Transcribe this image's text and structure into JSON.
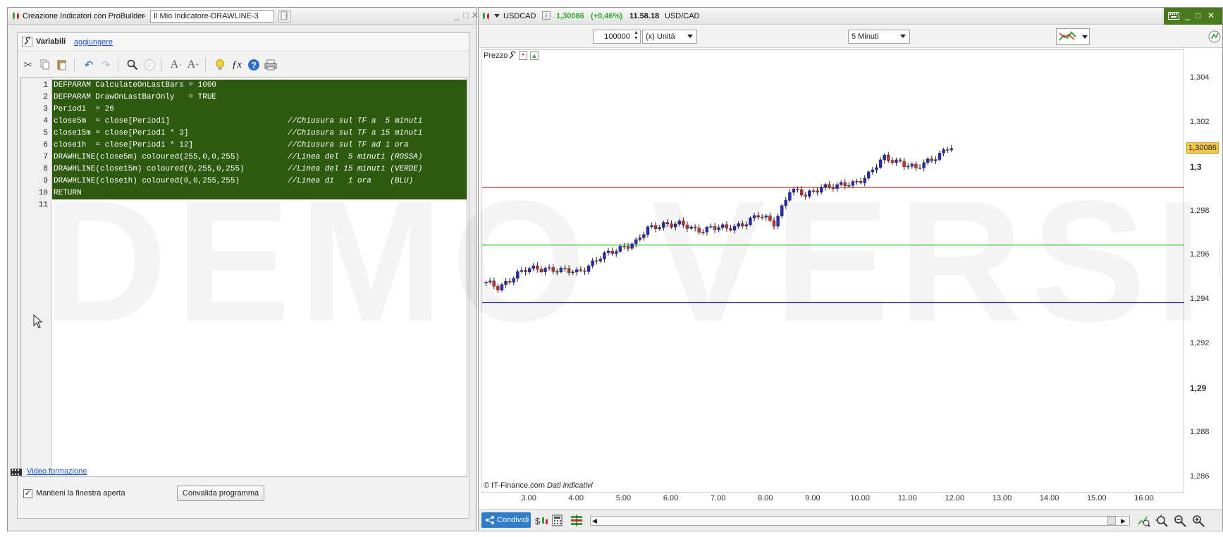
{
  "left_window": {
    "title": "Creazione Indicatori con ProBuilder",
    "title_sep": "-",
    "indicator_name": "Il Mio Indicatore-DRAWLINE-3",
    "variables_label": "Variabili",
    "add_link": "aggiungere",
    "code_lines": [
      {
        "n": "1",
        "code": "DEFPARAM CalculateOnLastBars = 1000",
        "comment": ""
      },
      {
        "n": "2",
        "code": "DEFPARAM DrawOnLastBarOnly   = TRUE",
        "comment": ""
      },
      {
        "n": "3",
        "code": "Periodi  = 26",
        "comment": ""
      },
      {
        "n": "4",
        "code": "close5m  = close[Periodi]",
        "comment": "//Chiusura sul TF a  5 minuti"
      },
      {
        "n": "5",
        "code": "close15m = close[Periodi * 3]",
        "comment": "//Chiusura sul TF a 15 minuti"
      },
      {
        "n": "6",
        "code": "close1h  = close[Periodi * 12]",
        "comment": "//Chiusura sul TF ad 1 ora"
      },
      {
        "n": "7",
        "code": "DRAWHLINE(close5m) coloured(255,0,0,255)",
        "comment": "//Linea del  5 minuti (ROSSA)"
      },
      {
        "n": "8",
        "code": "DRAWHLINE(close15m) coloured(0,255,0,255)",
        "comment": "//Linea del 15 minuti (VERDE)"
      },
      {
        "n": "9",
        "code": "DRAWHLINE(close1h) coloured(0,0,255,255)",
        "comment": "//Linea di   1 ora    (BLU)"
      },
      {
        "n": "10",
        "code": "RETURN",
        "comment": ""
      },
      {
        "n": "11",
        "code": "",
        "comment": ""
      }
    ],
    "keep_open_label": "Mantieni la finestra aperta",
    "keep_open_checked": true,
    "validate_button": "Convalida programma",
    "video_link": "Video formazione",
    "watermark_text": "DEMO VERSION",
    "selection_color": "#2d5a0f"
  },
  "right_window": {
    "symbol": "USDCAD",
    "price": "1,30086",
    "change": "(+0,46%)",
    "time": "11.58.18",
    "pair": "USD/CAD",
    "quantity": "100000",
    "unit": "(x) Unità",
    "timeframe": "5 Minuti",
    "price_panel_label": "Prezzo",
    "copyright": "© IT-Finance.com",
    "indicative": "Dati indicativi",
    "share_button": "Condividi",
    "accent_color": "#4a7a1e",
    "share_color": "#2f7ccb"
  },
  "chart_data": {
    "type": "candlestick",
    "y_ticks": [
      "1,304",
      "1,302",
      "1,3",
      "1,298",
      "1,296",
      "1,294",
      "1,292",
      "1,29",
      "1,288",
      "1,286"
    ],
    "ylim": [
      1.2853,
      1.3053
    ],
    "x_ticks": [
      "3.00",
      "4.00",
      "5.00",
      "6.00",
      "7.00",
      "8.00",
      "9.00",
      "10.00",
      "11.00",
      "12.00",
      "13.00",
      "14.00",
      "15.00",
      "16.00"
    ],
    "xlim": [
      2.0,
      16.85
    ],
    "last_price_label": "1,30086",
    "last_price": 1.30086,
    "hlines": [
      {
        "name": "close5m",
        "value": 1.2991,
        "color": "#c0392b"
      },
      {
        "name": "close15m",
        "value": 1.2965,
        "color": "#3cc83c"
      },
      {
        "name": "close1h",
        "value": 1.2939,
        "color": "#1f2a8a"
      }
    ],
    "close_series": [
      {
        "t": 2.0,
        "c": 1.2948
      },
      {
        "t": 2.33,
        "c": 1.2946
      },
      {
        "t": 2.67,
        "c": 1.2951
      },
      {
        "t": 3.0,
        "c": 1.2954
      },
      {
        "t": 3.33,
        "c": 1.2955
      },
      {
        "t": 3.67,
        "c": 1.2953
      },
      {
        "t": 4.0,
        "c": 1.2953
      },
      {
        "t": 4.33,
        "c": 1.2957
      },
      {
        "t": 4.67,
        "c": 1.2961
      },
      {
        "t": 5.0,
        "c": 1.2965
      },
      {
        "t": 5.25,
        "c": 1.2966
      },
      {
        "t": 5.5,
        "c": 1.2972
      },
      {
        "t": 5.83,
        "c": 1.2975
      },
      {
        "t": 6.17,
        "c": 1.2974
      },
      {
        "t": 6.5,
        "c": 1.2972
      },
      {
        "t": 6.83,
        "c": 1.2973
      },
      {
        "t": 7.17,
        "c": 1.2972
      },
      {
        "t": 7.5,
        "c": 1.2975
      },
      {
        "t": 7.83,
        "c": 1.2978
      },
      {
        "t": 8.17,
        "c": 1.2975
      },
      {
        "t": 8.5,
        "c": 1.299
      },
      {
        "t": 8.83,
        "c": 1.2987
      },
      {
        "t": 9.17,
        "c": 1.2992
      },
      {
        "t": 9.5,
        "c": 1.2991
      },
      {
        "t": 9.83,
        "c": 1.2993
      },
      {
        "t": 10.17,
        "c": 1.2997
      },
      {
        "t": 10.5,
        "c": 1.3004
      },
      {
        "t": 10.83,
        "c": 1.3003
      },
      {
        "t": 11.17,
        "c": 1.2999
      },
      {
        "t": 11.5,
        "c": 1.3004
      },
      {
        "t": 11.83,
        "c": 1.3009
      },
      {
        "t": 11.95,
        "c": 1.30086
      }
    ]
  }
}
